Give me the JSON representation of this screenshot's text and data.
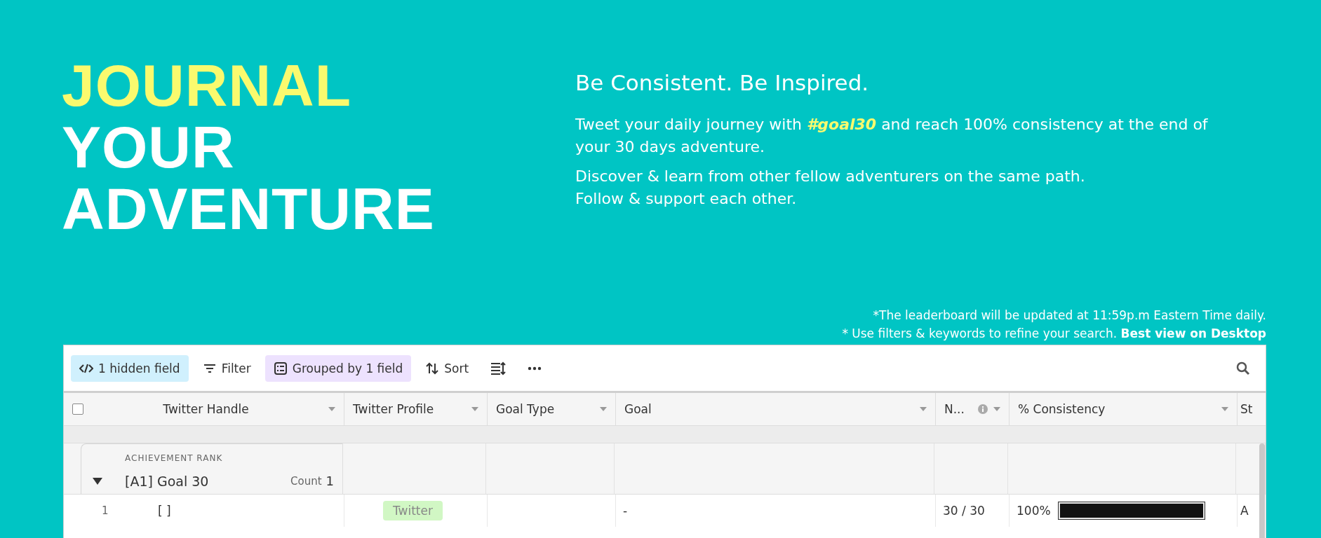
{
  "title_lines": [
    {
      "text": "JOURNAL",
      "color": "#fafa6e"
    },
    {
      "text": "YOUR",
      "color": "#ffffff"
    },
    {
      "text": "ADVENTURE",
      "color": "#ffffff"
    }
  ],
  "tagline": "Be Consistent. Be Inspired.",
  "paragraphs": [
    "Tweet your daily journey with *#goal30* and reach 100% consistency at the end of your 30 days adventure.",
    "Discover & learn from other fellow adventurers on the same path.\nFollow & support each other."
  ],
  "notes": [
    "*The leaderboard will be updated at 11:59p.m Eastern Time daily.",
    "* Use filters & keywords to refine your search. **Best view on Desktop**"
  ],
  "toolbar": [
    {
      "kind": "hidden",
      "label": "1 hidden field",
      "color": "#d0f0fd"
    },
    {
      "kind": "filter",
      "label": "Filter"
    },
    {
      "kind": "group",
      "label": "Grouped by 1 field",
      "color": "#ede2fe"
    },
    {
      "kind": "sort",
      "label": "Sort"
    },
    {
      "kind": "height"
    },
    {
      "kind": "more"
    }
  ],
  "table": {
    "columns": [
      {
        "label": "Twitter Handle"
      },
      {
        "label": "Twitter Profile"
      },
      {
        "label": "Goal Type"
      },
      {
        "label": "Goal"
      },
      {
        "label": "N...",
        "info": true
      },
      {
        "label": "% Consistency"
      },
      {
        "label": "St"
      }
    ],
    "select_all": {
      "checked": false
    },
    "group": {
      "field": "ACHIEVEMENT RANK",
      "name": "[A1] Goal 30",
      "count_label": "Count",
      "count": "1",
      "expanded": true
    },
    "rows": [
      {
        "number": "1",
        "handle": "[ ]",
        "profile": "Twitter",
        "goal_type": "",
        "goal": "-",
        "n": "30 / 30",
        "consistency": "100%",
        "level": 1,
        "status": "A"
      }
    ]
  }
}
